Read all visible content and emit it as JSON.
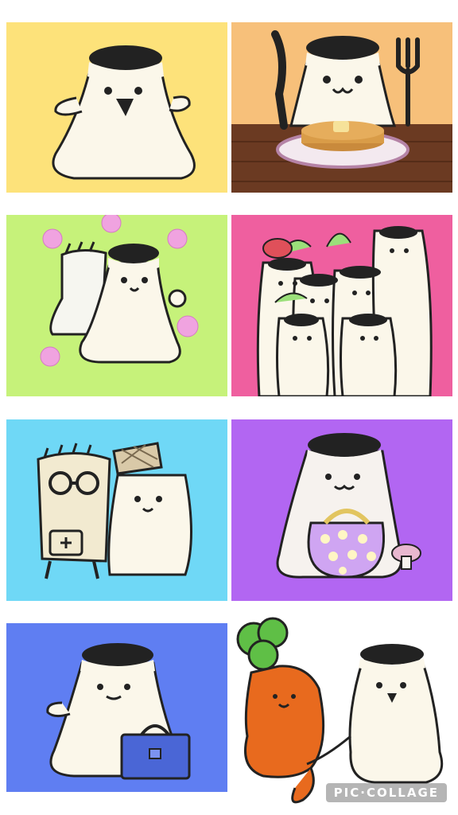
{
  "collage": {
    "watermark": "PIC·COLLAGE",
    "tiles": [
      {
        "name": "tile-yellow",
        "subject": "ghost-character",
        "background": "#fde27a"
      },
      {
        "name": "tile-orange",
        "subject": "ghost-eating-pancakes",
        "background": "#f7c07a"
      },
      {
        "name": "tile-lime",
        "subject": "ghost-with-flowers",
        "background": "#c6f27a"
      },
      {
        "name": "tile-pink",
        "subject": "crowd-of-ghosts",
        "background": "#ef5f9f"
      },
      {
        "name": "tile-sky",
        "subject": "ghost-with-doctor-glove",
        "background": "#6fd8f6"
      },
      {
        "name": "tile-violet",
        "subject": "ghost-with-polka-dot-purse",
        "background": "#b266f2"
      },
      {
        "name": "tile-blue",
        "subject": "ghost-with-briefcase",
        "background": "#5f7ef2"
      },
      {
        "name": "tile-white",
        "subject": "ghost-with-carrot",
        "background": "#ffffff"
      }
    ]
  }
}
